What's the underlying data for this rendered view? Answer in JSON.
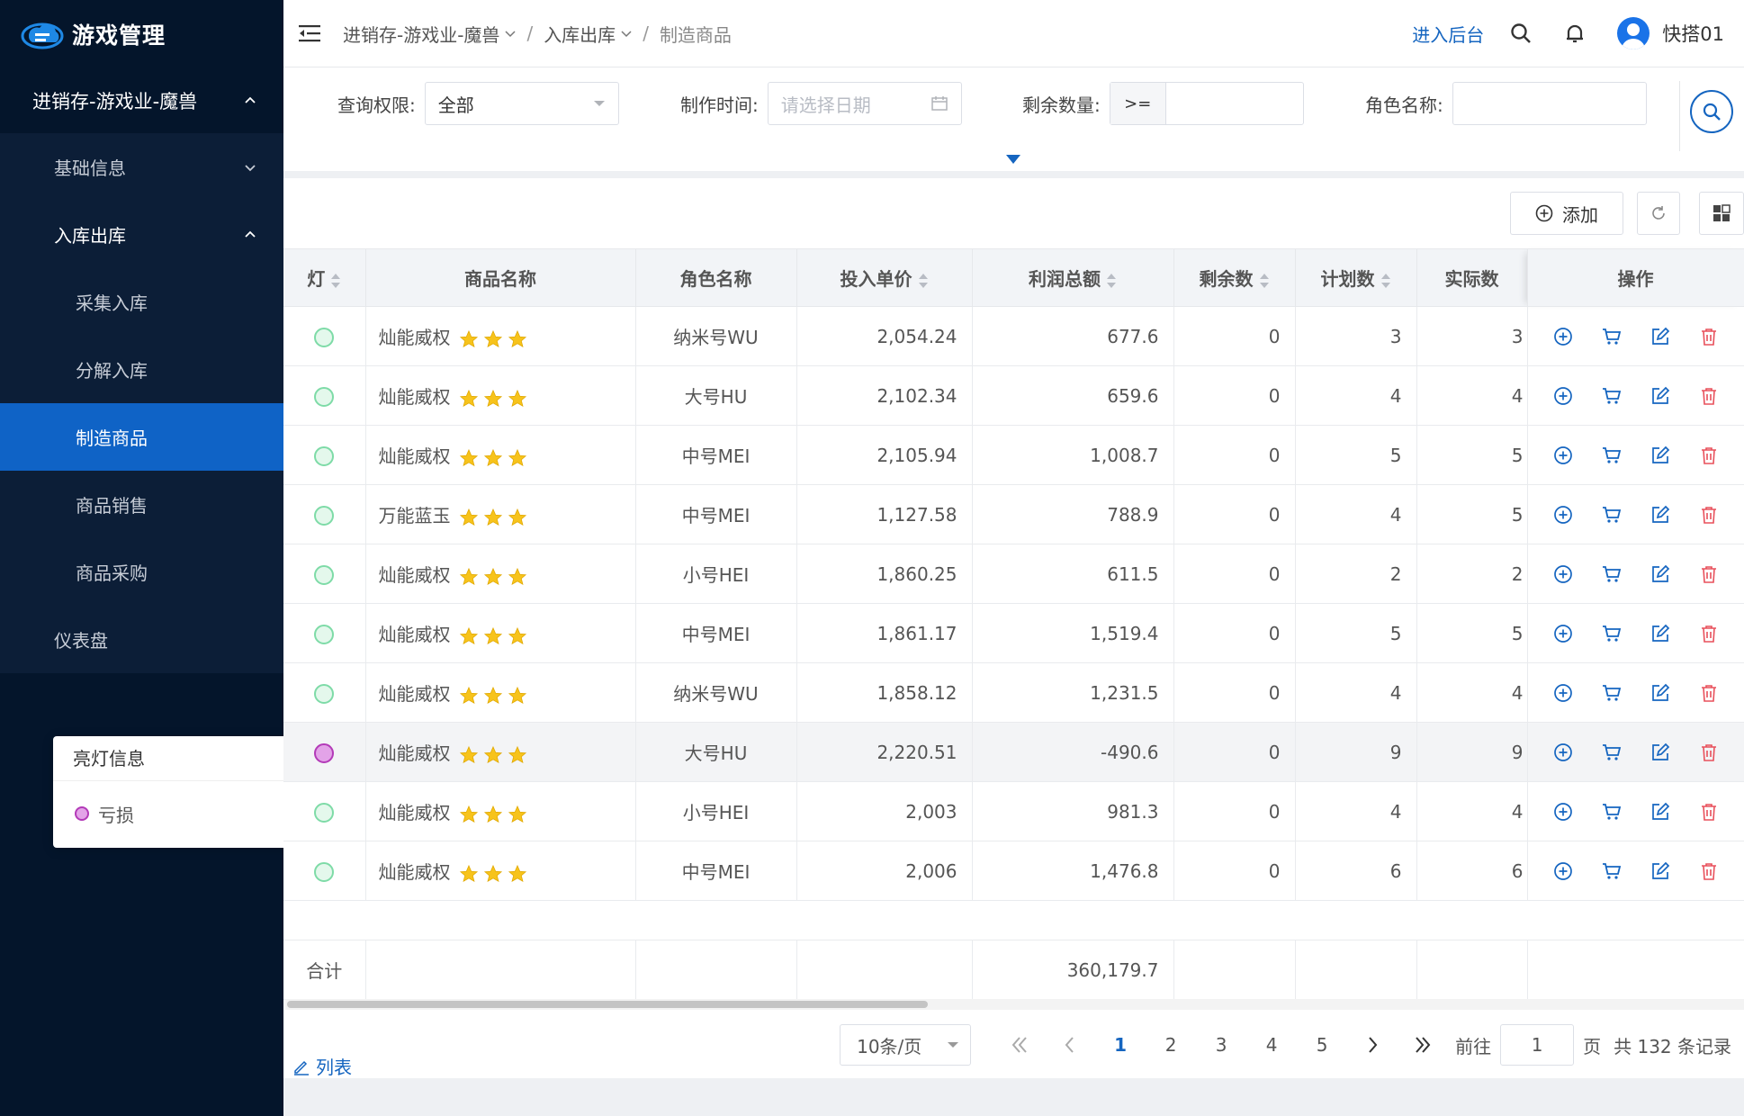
{
  "app": {
    "title": "游戏管理"
  },
  "sidebar": {
    "top": {
      "label": "进销存-游戏业-魔兽"
    },
    "groups": [
      {
        "label": "基础信息"
      },
      {
        "label": "入库出库"
      }
    ],
    "items": [
      {
        "label": "采集入库"
      },
      {
        "label": "分解入库"
      },
      {
        "label": "制造商品"
      },
      {
        "label": "商品销售"
      },
      {
        "label": "商品采购"
      }
    ],
    "dashboard": {
      "label": "仪表盘"
    }
  },
  "header": {
    "breadcrumb": [
      "进销存-游戏业-魔兽",
      "入库出库",
      "制造商品"
    ],
    "separator": "/",
    "admin_link": "进入后台",
    "username": "快搭01"
  },
  "filters": {
    "scope_label": "查询权限:",
    "scope_value": "全部",
    "time_label": "制作时间:",
    "time_placeholder": "请选择日期",
    "remain_label": "剩余数量:",
    "remain_op": ">=",
    "role_label": "角色名称:"
  },
  "toolbar": {
    "add_label": "添加"
  },
  "table": {
    "headers": [
      "灯",
      "商品名称",
      "角色名称",
      "投入单价",
      "利润总额",
      "剩余数",
      "计划数",
      "实际数",
      "操作"
    ],
    "rows": [
      {
        "light": "ok",
        "name": "灿能威权",
        "role": "纳米号WU",
        "price": "2,054.24",
        "profit": "677.6",
        "remain": "0",
        "plan": "3",
        "actual": "3"
      },
      {
        "light": "ok",
        "name": "灿能威权",
        "role": "大号HU",
        "price": "2,102.34",
        "profit": "659.6",
        "remain": "0",
        "plan": "4",
        "actual": "4"
      },
      {
        "light": "ok",
        "name": "灿能威权",
        "role": "中号MEI",
        "price": "2,105.94",
        "profit": "1,008.7",
        "remain": "0",
        "plan": "5",
        "actual": "5"
      },
      {
        "light": "ok",
        "name": "万能蓝玉",
        "role": "中号MEI",
        "price": "1,127.58",
        "profit": "788.9",
        "remain": "0",
        "plan": "4",
        "actual": "5"
      },
      {
        "light": "ok",
        "name": "灿能威权",
        "role": "小号HEI",
        "price": "1,860.25",
        "profit": "611.5",
        "remain": "0",
        "plan": "2",
        "actual": "2"
      },
      {
        "light": "ok",
        "name": "灿能威权",
        "role": "中号MEI",
        "price": "1,861.17",
        "profit": "1,519.4",
        "remain": "0",
        "plan": "5",
        "actual": "5"
      },
      {
        "light": "ok",
        "name": "灿能威权",
        "role": "纳米号WU",
        "price": "1,858.12",
        "profit": "1,231.5",
        "remain": "0",
        "plan": "4",
        "actual": "4"
      },
      {
        "light": "loss",
        "name": "灿能威权",
        "role": "大号HU",
        "price": "2,220.51",
        "profit": "-490.6",
        "remain": "0",
        "plan": "9",
        "actual": "9"
      },
      {
        "light": "ok",
        "name": "灿能威权",
        "role": "小号HEI",
        "price": "2,003",
        "profit": "981.3",
        "remain": "0",
        "plan": "4",
        "actual": "4"
      },
      {
        "light": "ok",
        "name": "灿能威权",
        "role": "中号MEI",
        "price": "2,006",
        "profit": "1,476.8",
        "remain": "0",
        "plan": "6",
        "actual": "6"
      }
    ],
    "total_label": "合计",
    "total_profit": "360,179.7"
  },
  "pagination": {
    "page_size": "10条/页",
    "pages": [
      "1",
      "2",
      "3",
      "4",
      "5"
    ],
    "current": "1",
    "goto_label": "前往",
    "goto_value": "1",
    "page_unit": "页",
    "total_text": "共 132 条记录"
  },
  "list_link": "列表",
  "legend_popover": {
    "title": "亮灯信息",
    "items": [
      {
        "label": "亏损",
        "color": "#e3a3e8"
      }
    ]
  },
  "colors": {
    "sidebar_bg": "#04152b",
    "active": "#0f63c6",
    "accent": "#1565c0",
    "loss": "#b33ab8",
    "ok": "#7edba7",
    "star": "#f7c31b",
    "danger": "#e8505b"
  }
}
